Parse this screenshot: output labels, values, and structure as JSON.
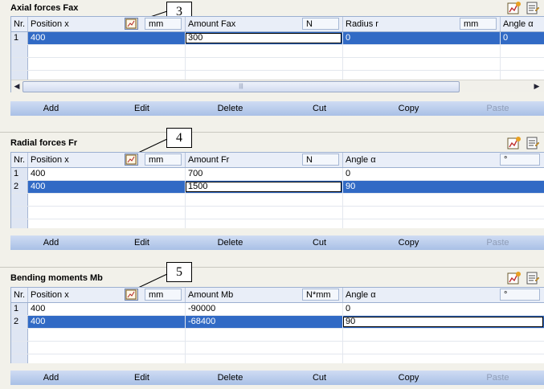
{
  "common": {
    "nr_label": "Nr.",
    "buttons": [
      "Add",
      "Edit",
      "Delete",
      "Cut",
      "Copy",
      "Paste"
    ]
  },
  "axial": {
    "title": "Axial forces Fax",
    "callout": "3",
    "col_position": "Position x",
    "unit_position": "mm",
    "col_amount": "Amount Fax",
    "unit_amount": "N",
    "col_radius": "Radius r",
    "unit_radius": "mm",
    "col_angle": "Angle α",
    "rows": [
      {
        "nr": "1",
        "position": "400",
        "amount": "300",
        "radius": "0",
        "angle": "0"
      }
    ],
    "scroll_grip": "|||"
  },
  "radial": {
    "title": "Radial forces Fr",
    "callout": "4",
    "col_position": "Position x",
    "unit_position": "mm",
    "col_amount": "Amount Fr",
    "unit_amount": "N",
    "col_angle": "Angle α",
    "unit_angle": "°",
    "rows": [
      {
        "nr": "1",
        "position": "400",
        "amount": "700",
        "angle": "0"
      },
      {
        "nr": "2",
        "position": "400",
        "amount": "1500",
        "angle": "90"
      }
    ]
  },
  "bending": {
    "title": "Bending moments Mb",
    "callout": "5",
    "col_position": "Position x",
    "unit_position": "mm",
    "col_amount": "Amount Mb",
    "unit_amount": "N*mm",
    "col_angle": "Angle α",
    "unit_angle": "°",
    "rows": [
      {
        "nr": "1",
        "position": "400",
        "amount": "-90000",
        "angle": "0"
      },
      {
        "nr": "2",
        "position": "400",
        "amount": "-68400",
        "angle": "90"
      }
    ]
  }
}
